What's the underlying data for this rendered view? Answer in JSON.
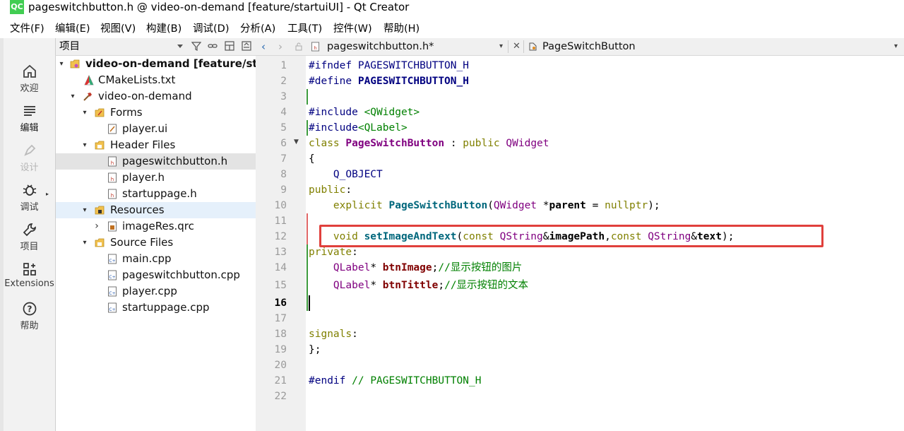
{
  "window": {
    "logo": "QC",
    "title": "pageswitchbutton.h @ video-on-demand [feature/startuiUI] - Qt Creator"
  },
  "menu": [
    "文件(F)",
    "编辑(E)",
    "视图(V)",
    "构建(B)",
    "调试(D)",
    "分析(A)",
    "工具(T)",
    "控件(W)",
    "帮助(H)"
  ],
  "modes": [
    {
      "label": "欢迎",
      "icon": "home-icon"
    },
    {
      "label": "编辑",
      "icon": "edit-lines-icon"
    },
    {
      "label": "设计",
      "icon": "pen-icon"
    },
    {
      "label": "调试",
      "icon": "bug-icon"
    },
    {
      "label": "项目",
      "icon": "wrench-icon"
    },
    {
      "label": "Extensions",
      "icon": "extensions-icon"
    },
    {
      "label": "帮助",
      "icon": "help-icon"
    }
  ],
  "project_panel": {
    "title": "项目",
    "tree": [
      {
        "label": "video-on-demand [feature/star",
        "arrow": "▾",
        "icon": "project-folder-icon"
      },
      {
        "label": "CMakeLists.txt",
        "arrow": "",
        "icon": "cmake-icon"
      },
      {
        "label": "video-on-demand",
        "arrow": "▾",
        "icon": "hammer-icon"
      },
      {
        "label": "Forms",
        "arrow": "▾",
        "icon": "forms-folder-icon"
      },
      {
        "label": "player.ui",
        "arrow": "",
        "icon": "ui-file-icon"
      },
      {
        "label": "Header Files",
        "arrow": "▾",
        "icon": "header-folder-icon"
      },
      {
        "label": "pageswitchbutton.h",
        "arrow": "",
        "icon": "header-file-icon"
      },
      {
        "label": "player.h",
        "arrow": "",
        "icon": "header-file-icon"
      },
      {
        "label": "startuppage.h",
        "arrow": "",
        "icon": "header-file-icon"
      },
      {
        "label": "Resources",
        "arrow": "▾",
        "icon": "resources-folder-icon"
      },
      {
        "label": "imageRes.qrc",
        "arrow": "›",
        "icon": "qrc-file-icon"
      },
      {
        "label": "Source Files",
        "arrow": "▾",
        "icon": "source-folder-icon"
      },
      {
        "label": "main.cpp",
        "arrow": "",
        "icon": "cpp-file-icon"
      },
      {
        "label": "pageswitchbutton.cpp",
        "arrow": "",
        "icon": "cpp-file-icon"
      },
      {
        "label": "player.cpp",
        "arrow": "",
        "icon": "cpp-file-icon"
      },
      {
        "label": "startuppage.cpp",
        "arrow": "",
        "icon": "cpp-file-icon"
      }
    ]
  },
  "editor": {
    "file_tab": "pageswitchbutton.h*",
    "symbol": "PageSwitchButton",
    "current_line": "16",
    "line_numbers": [
      "1",
      "2",
      "3",
      "4",
      "5",
      "6",
      "7",
      "8",
      "9",
      "10",
      "11",
      "12",
      "13",
      "14",
      "15",
      "16",
      "17",
      "18",
      "19",
      "20",
      "21",
      "22"
    ],
    "code": {
      "l1a": "#ifndef",
      "l1b": "PAGESWITCHBUTTON_H",
      "l2a": "#define",
      "l2b": "PAGESWITCHBUTTON_H",
      "l4a": "#include",
      "l4b": "<QWidget>",
      "l5a": "#include",
      "l5b": "<QLabel>",
      "l6a": "class",
      "l6b": "PageSwitchButton",
      "l6c": ":",
      "l6d": "public",
      "l6e": "QWidget",
      "l7": "{",
      "l8": "Q_OBJECT",
      "l9a": "public",
      "l9b": ":",
      "l10a": "explicit",
      "l10b": "PageSwitchButton",
      "l10c": "(",
      "l10d": "QWidget",
      "l10e": "*",
      "l10f": "parent",
      "l10g": "=",
      "l10h": "nullptr",
      "l10i": ");",
      "l12a": "void",
      "l12b": "setImageAndText",
      "l12c": "(",
      "l12d": "const",
      "l12e": "QString",
      "l12f": "&",
      "l12g": "imagePath",
      "l12h": ",",
      "l12i": "const",
      "l12j": "QString",
      "l12k": "&",
      "l12l": "text",
      "l12m": ");",
      "l13a": "private",
      "l13b": ":",
      "l14a": "QLabel",
      "l14b": "*",
      "l14c": "btnImage",
      "l14d": ";",
      "l14e": "//显示按钮的图片",
      "l15a": "QLabel",
      "l15b": "*",
      "l15c": "btnTittle",
      "l15d": ";",
      "l15e": "//显示按钮的文本",
      "l18a": "signals",
      "l18b": ":",
      "l19": "};",
      "l21a": "#endif",
      "l21b": "// PAGESWITCHBUTTON_H"
    }
  },
  "colors": {
    "accent": "#e0403c",
    "gutter_mod_red": "#e06666",
    "gutter_mod_green": "#3c9a3c",
    "logo_green": "#41cd52"
  }
}
